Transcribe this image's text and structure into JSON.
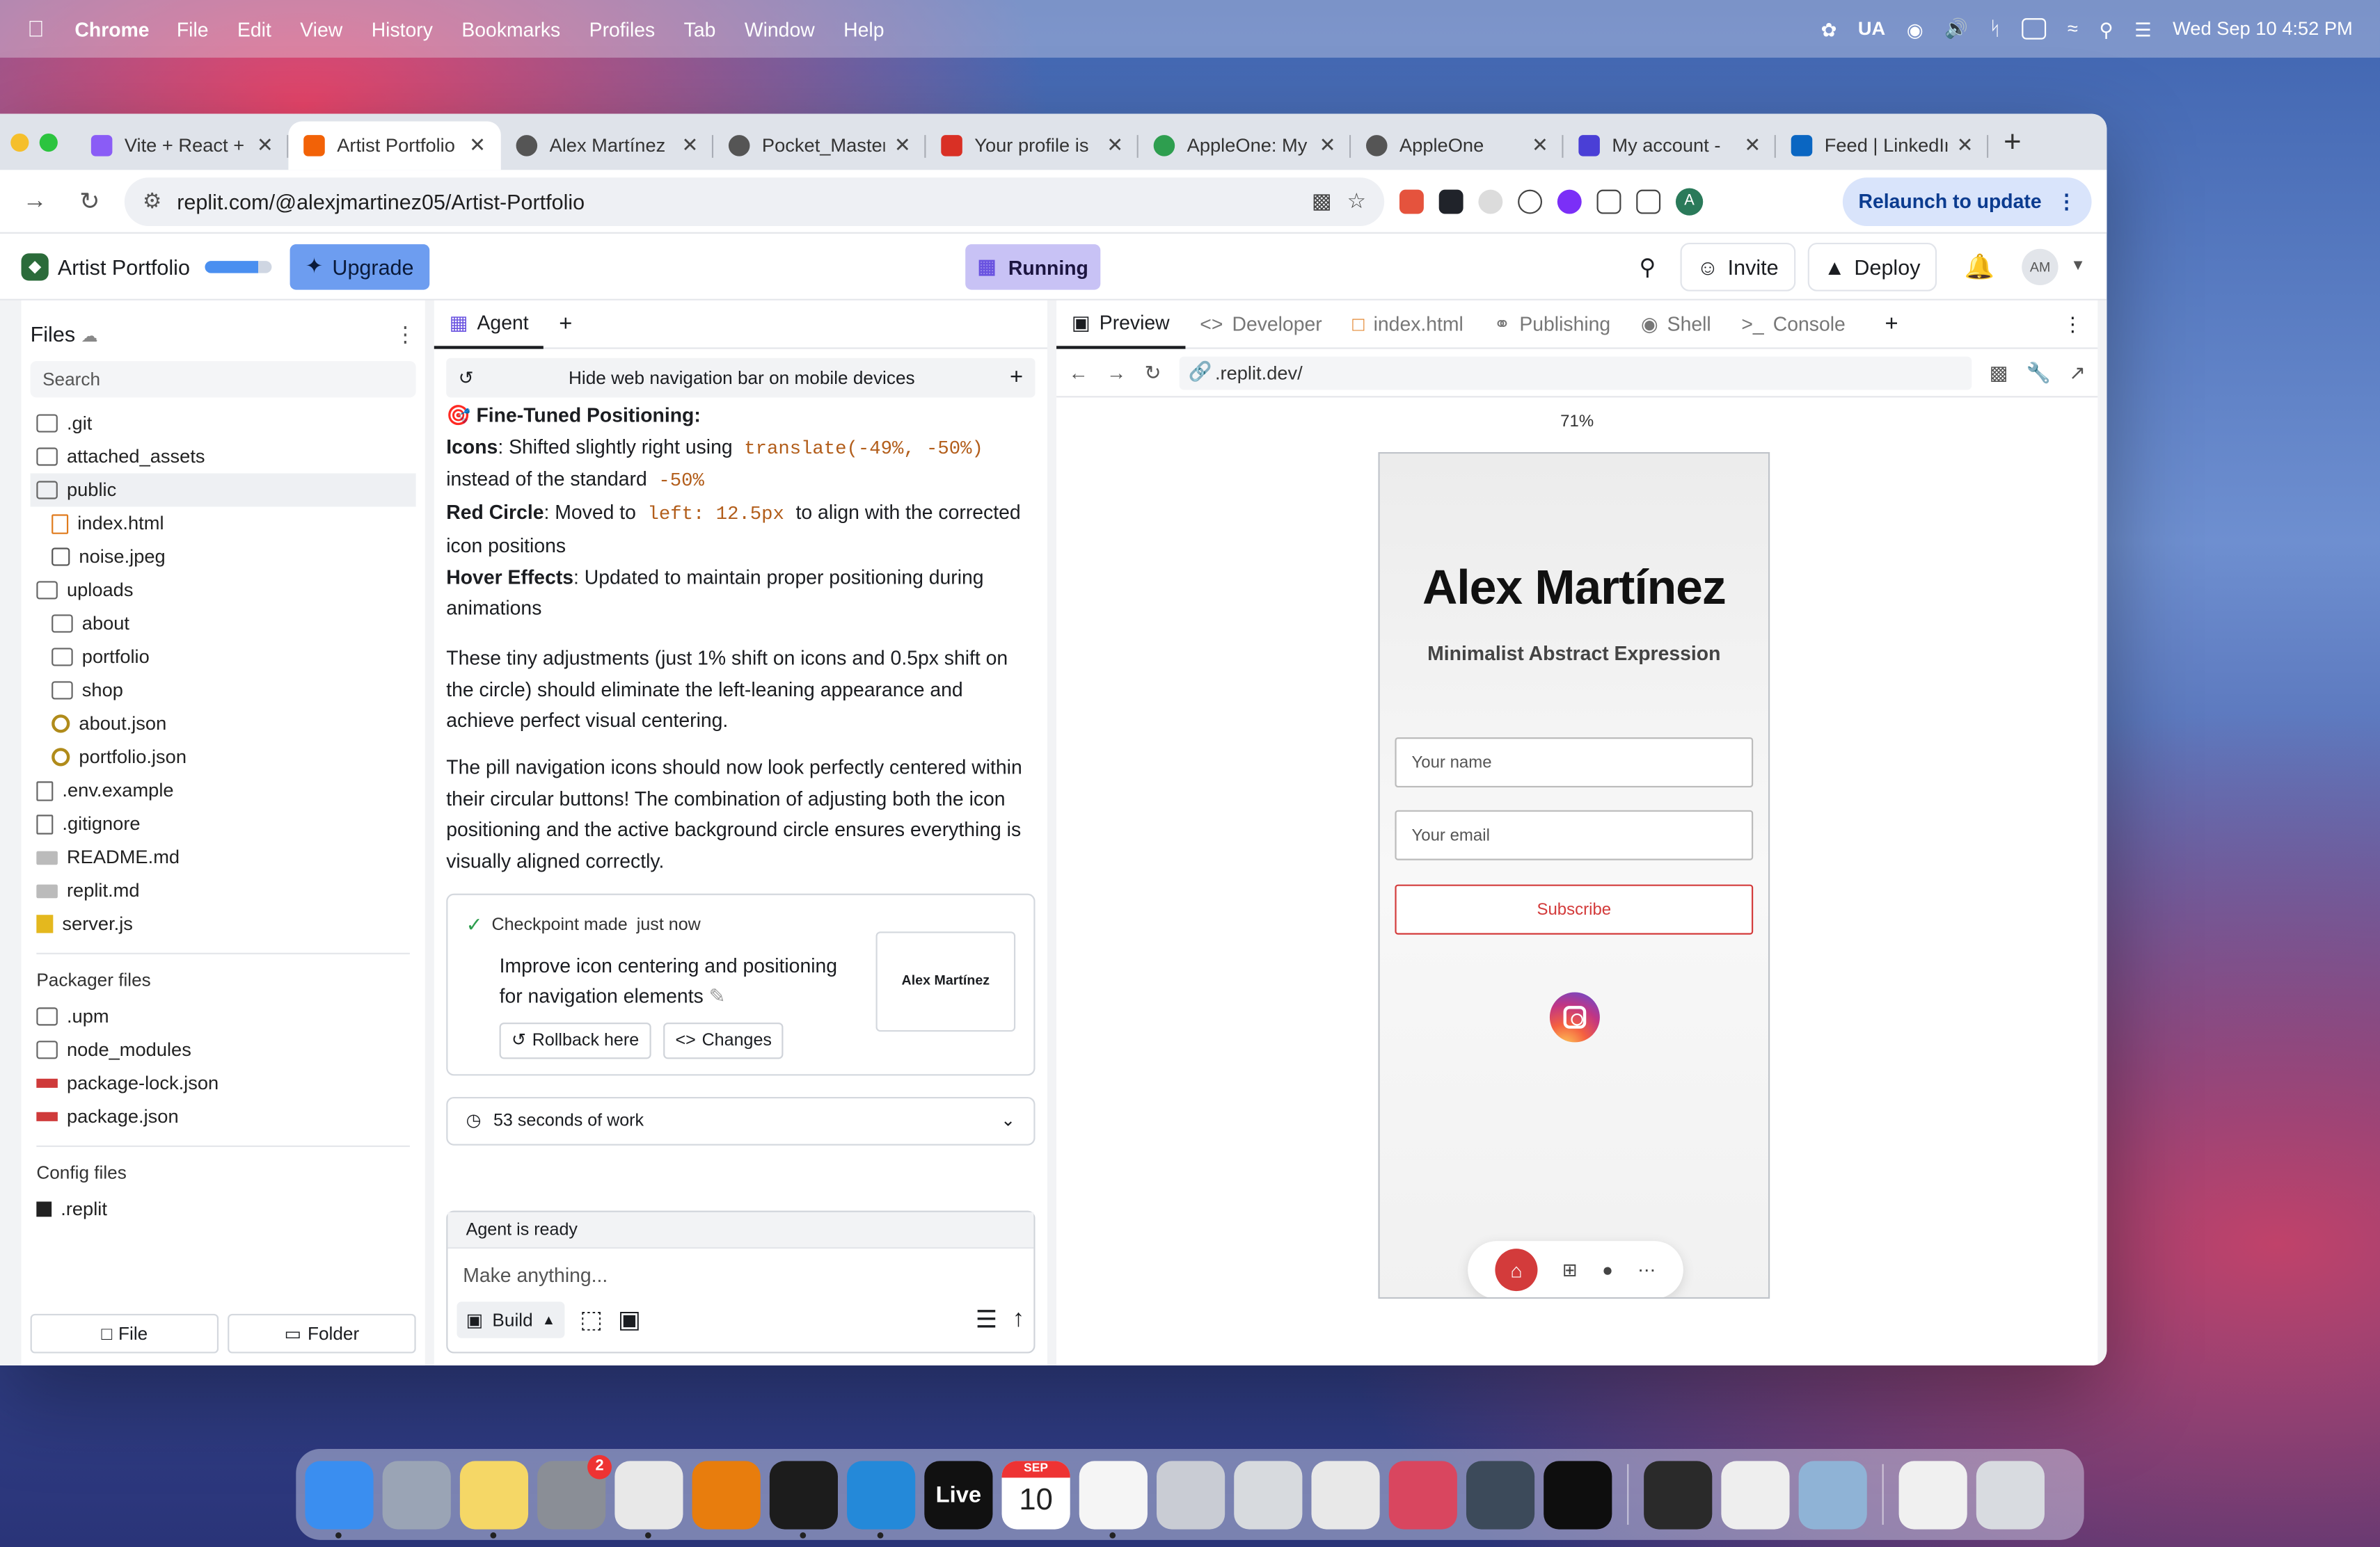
{
  "menubar": {
    "app": "Chrome",
    "items": [
      "File",
      "Edit",
      "View",
      "History",
      "Bookmarks",
      "Profiles",
      "Tab",
      "Window",
      "Help"
    ],
    "input_source": "UA",
    "datetime": "Wed Sep 10  4:52 PM"
  },
  "tabs": [
    {
      "title": "Vite + React +",
      "color": "#8a5cf6"
    },
    {
      "title": "Artist Portfolio",
      "color": "#f26207",
      "active": true
    },
    {
      "title": "Alex Martínez",
      "color": "#555555"
    },
    {
      "title": "Pocket_Master",
      "color": "#555555"
    },
    {
      "title": "Your profile is",
      "color": "#d93025"
    },
    {
      "title": "AppleOne: My",
      "color": "#2e9e4f"
    },
    {
      "title": "AppleOne",
      "color": "#555555"
    },
    {
      "title": "My account -",
      "color": "#4a3fd6"
    },
    {
      "title": "Feed | LinkedIn",
      "color": "#0a66c2"
    }
  ],
  "address": {
    "url": "replit.com/@alexjmartinez05/Artist-Portfolio",
    "relaunch": "Relaunch to update",
    "profile_initial": "A"
  },
  "appbar": {
    "title": "Artist Portfolio",
    "upgrade": "Upgrade",
    "status": "Running",
    "invite": "Invite",
    "deploy": "Deploy",
    "avatar": "AM"
  },
  "files": {
    "title": "Files",
    "search_placeholder": "Search",
    "items": [
      {
        "name": ".git",
        "type": "folder",
        "indent": false
      },
      {
        "name": "attached_assets",
        "type": "folder",
        "indent": false
      },
      {
        "name": "public",
        "type": "folder",
        "indent": false,
        "selected": true
      },
      {
        "name": "index.html",
        "type": "html",
        "indent": true
      },
      {
        "name": "noise.jpeg",
        "type": "img",
        "indent": true
      },
      {
        "name": "uploads",
        "type": "folder",
        "indent": false
      },
      {
        "name": "about",
        "type": "folder",
        "indent": true
      },
      {
        "name": "portfolio",
        "type": "folder",
        "indent": true
      },
      {
        "name": "shop",
        "type": "folder",
        "indent": true
      },
      {
        "name": "about.json",
        "type": "json",
        "indent": true
      },
      {
        "name": "portfolio.json",
        "type": "json",
        "indent": true
      },
      {
        "name": ".env.example",
        "type": "doc",
        "indent": false
      },
      {
        "name": ".gitignore",
        "type": "doc",
        "indent": false
      },
      {
        "name": "README.md",
        "type": "md",
        "indent": false
      },
      {
        "name": "replit.md",
        "type": "md",
        "indent": false
      },
      {
        "name": "server.js",
        "type": "js",
        "indent": false
      }
    ],
    "packager_title": "Packager files",
    "packager": [
      {
        "name": ".upm",
        "type": "folder"
      },
      {
        "name": "node_modules",
        "type": "folder"
      },
      {
        "name": "package-lock.json",
        "type": "npm"
      },
      {
        "name": "package.json",
        "type": "npm"
      }
    ],
    "config_title": "Config files",
    "config": [
      {
        "name": ".replit",
        "type": "replit"
      }
    ],
    "btn_file": "File",
    "btn_folder": "Folder"
  },
  "agent": {
    "tab": "Agent",
    "history_title": "Hide web navigation bar on mobile devices",
    "heading": "Fine-Tuned Positioning:",
    "icons_label": "Icons",
    "icons_text1": ": Shifted slightly right using",
    "icons_code1": "translate(-49%, -50%)",
    "icons_text2": "instead of the standard",
    "icons_code2": "-50%",
    "circle_label": "Red Circle",
    "circle_text1": ": Moved to",
    "circle_code": "left: 12.5px",
    "circle_text2": "to align with the corrected icon positions",
    "hover_label": "Hover Effects",
    "hover_text": ": Updated to maintain proper positioning during animations",
    "para1": "These tiny adjustments (just 1% shift on icons and 0.5px shift on the circle) should eliminate the left-leaning appearance and achieve perfect visual centering.",
    "para2": "The pill navigation icons should now look perfectly centered within their circular buttons! The combination of adjusting both the icon positioning and the active background circle ensures everything is visually aligned correctly.",
    "checkpoint_label": "Checkpoint made",
    "checkpoint_time": "just now",
    "checkpoint_text": "Improve icon centering and positioning for navigation elements",
    "rollback": "Rollback here",
    "changes": "Changes",
    "thumb_title": "Alex Martínez",
    "work": "53 seconds of work",
    "ready": "Agent is ready",
    "prompt_placeholder": "Make anything...",
    "build": "Build"
  },
  "preview": {
    "tabs": [
      "Preview",
      "Developer",
      "index.html",
      "Publishing",
      "Shell",
      "Console"
    ],
    "url": ".replit.dev/",
    "zoom": "71%",
    "site_name": "Alex Martínez",
    "tagline": "Minimalist Abstract Expression",
    "name_placeholder": "Your name",
    "email_placeholder": "Your email",
    "subscribe": "Subscribe"
  },
  "dock": {
    "apps": [
      {
        "name": "Finder",
        "color": "#3a8ef0",
        "running": true
      },
      {
        "name": "Launchpad",
        "color": "#9aa4b5"
      },
      {
        "name": "Notes",
        "color": "#f5d766",
        "running": true
      },
      {
        "name": "System Settings",
        "color": "#8a8e96",
        "badge": "2"
      },
      {
        "name": "Chrome",
        "color": "#e8e8e8",
        "running": true
      },
      {
        "name": "Blender",
        "color": "#e87d0d"
      },
      {
        "name": "Terminal",
        "color": "#1c1c1c",
        "running": true
      },
      {
        "name": "VS Code",
        "color": "#2489d9",
        "running": true
      },
      {
        "name": "Live",
        "color": "#111111",
        "label": "Live"
      },
      {
        "name": "Calendar",
        "color": "#ffffff",
        "label": "10",
        "month": "SEP"
      },
      {
        "name": "ChatGPT",
        "color": "#f5f5f5",
        "running": true
      },
      {
        "name": "Automator",
        "color": "#c9ccd4"
      },
      {
        "name": "Keyboard",
        "color": "#d7dade"
      },
      {
        "name": "Script Editor",
        "color": "#e8e8e8"
      },
      {
        "name": "Shortcuts",
        "color": "#d9465f"
      },
      {
        "name": "DaVinci Resolve",
        "color": "#3c4a5a"
      },
      {
        "name": "Cursor",
        "color": "#0e0e0e"
      },
      {
        "name": "Aperture",
        "color": "#2a2a2a"
      },
      {
        "name": "TextEdit",
        "color": "#eeeeee"
      },
      {
        "name": "Preview",
        "color": "#8fb3d6"
      },
      {
        "name": "Document",
        "color": "#f0f0f0"
      },
      {
        "name": "Trash",
        "color": "#d8dbe0"
      }
    ]
  }
}
